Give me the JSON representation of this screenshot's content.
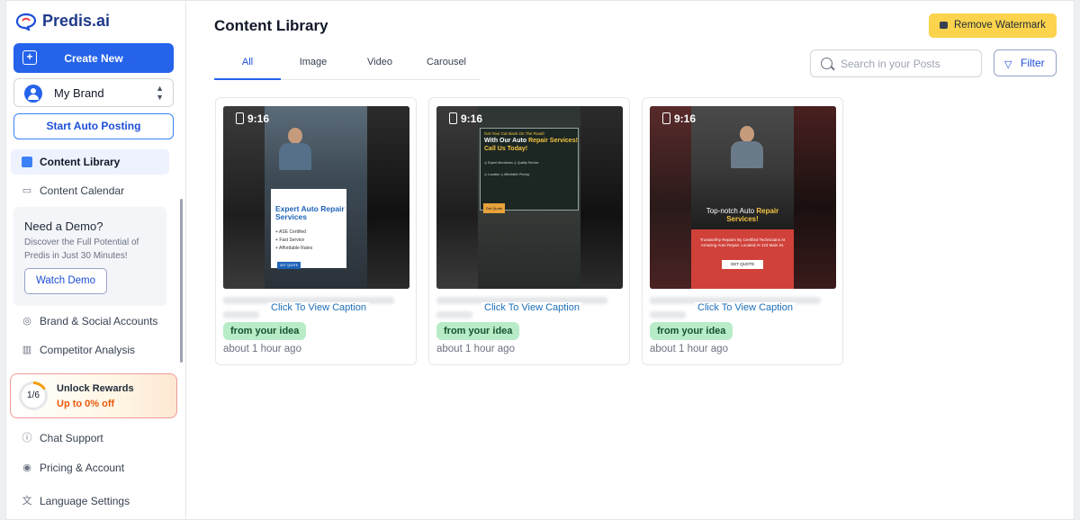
{
  "app": {
    "logo_text": "Predis.ai"
  },
  "sidebar": {
    "create_new": "Create New",
    "brand": "My Brand",
    "start_auto_posting": "Start Auto Posting",
    "nav_top": [
      {
        "label": "Content Library",
        "active": true
      },
      {
        "label": "Content Calendar",
        "active": false
      }
    ],
    "demo": {
      "title": "Need a Demo?",
      "subtitle": "Discover the Full Potential of Predis in Just 30 Minutes!",
      "button": "Watch Demo"
    },
    "nav_mid": [
      {
        "label": "Brand & Social Accounts"
      },
      {
        "label": "Competitor Analysis"
      }
    ],
    "rewards": {
      "progress": "1/6",
      "title": "Unlock Rewards",
      "subtitle": "Up to 0% off"
    },
    "nav_bottom": [
      {
        "label": "Chat Support"
      },
      {
        "label": "Pricing & Account"
      },
      {
        "label": "Language Settings"
      }
    ]
  },
  "header": {
    "title": "Content Library",
    "remove_watermark": "Remove Watermark",
    "search_placeholder": "Search in your Posts",
    "filter": "Filter"
  },
  "tabs": [
    {
      "label": "All",
      "active": true
    },
    {
      "label": "Image",
      "active": false
    },
    {
      "label": "Video",
      "active": false
    },
    {
      "label": "Carousel",
      "active": false
    }
  ],
  "cards": [
    {
      "ratio": "9:16",
      "poster": {
        "title": "Expert Auto Repair Services",
        "items": [
          "ASE Certified",
          "Fast Service",
          "Affordable Rates"
        ],
        "button": "GET QUOTE"
      },
      "caption_link": "Click To View Caption",
      "tag": "from your idea",
      "time": "about 1 hour ago"
    },
    {
      "ratio": "9:16",
      "poster": {
        "top": "Get Your Car Back On The Road!",
        "title_a": "With Our Auto ",
        "title_b": "Repair Services!",
        "title_c": " Call Us Today!",
        "features": [
          "Expert Mechanics",
          "Quality Service",
          "Location",
          "Affordable Pricing"
        ],
        "button": "Get Quote"
      },
      "caption_link": "Click To View Caption",
      "tag": "from your idea",
      "time": "about 1 hour ago"
    },
    {
      "ratio": "9:16",
      "poster": {
        "title_a": "Top-notch Auto ",
        "title_b": "Repair Services!",
        "subtitle": "Trustworthy Repairs By Certified Technicians At Amazing Auto Repair. Located At 123 Main St.",
        "button": "GET QUOTE"
      },
      "caption_link": "Click To View Caption",
      "tag": "from your idea",
      "time": "about 1 hour ago"
    }
  ]
}
